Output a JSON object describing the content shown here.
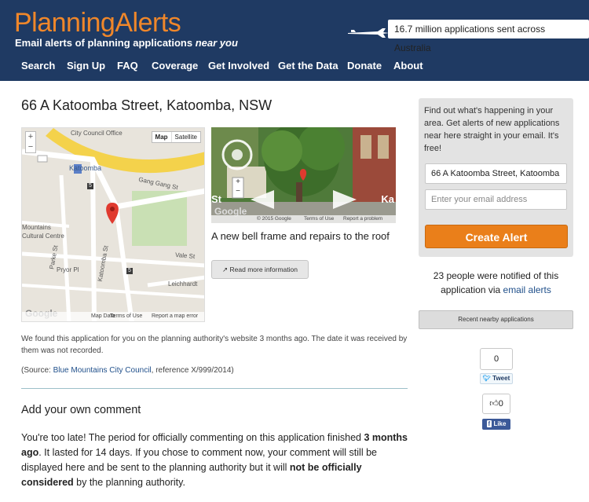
{
  "header": {
    "logo": "PlanningAlerts",
    "tagline_main": "Email alerts of planning applications ",
    "tagline_em": "near you",
    "stat": "16.7 million applications sent across Australia"
  },
  "nav": [
    "Search",
    "Sign Up",
    "FAQ",
    "Coverage",
    "Get Involved",
    "Get the Data",
    "Donate",
    "About"
  ],
  "application": {
    "address": "66 A Katoomba Street, Katoomba, NSW",
    "description": "A new bell frame and repairs to the roof",
    "read_more": "Read more information",
    "found_note": "We found this application for you on the planning authority's website 3 months ago. The date it was received by them was not recorded.",
    "source_prefix": "(Source: ",
    "source_link": "Blue Mountains City Council",
    "source_suffix": ", reference X/999/2014)"
  },
  "map": {
    "mode_map": "Map",
    "mode_satellite": "Satellite",
    "zoom_in": "+",
    "zoom_out": "−",
    "labels": [
      "City Council Office",
      "Katoomba",
      "Gang Gang St",
      "Parke St",
      "Pryor Pl",
      "Vale St",
      "Leichhardt",
      "Katoomba St",
      "Mountains",
      "Cultural Centre"
    ],
    "road_numbers": [
      "5",
      "5"
    ],
    "footer": [
      "Map Data",
      "Terms of Use",
      "Report a map error"
    ],
    "google": "Google"
  },
  "streetview": {
    "left_label": "St",
    "right_label": "Ka",
    "footer": [
      "© 2015 Google",
      "Terms of Use",
      "Report a problem"
    ],
    "google": "Google"
  },
  "comment": {
    "heading": "Add your own comment",
    "p1": "You're too late! The period for officially commenting on this application finished ",
    "p1_bold": "3 months ago",
    "p2": ". It lasted for 14 days. If you chose to comment now, your comment will still be displayed here and be sent to the planning authority but it will ",
    "p2_bold": "not be officially considered",
    "p3": " by the planning authority."
  },
  "sidebar": {
    "signup_text": "Find out what's happening in your area. Get alerts of new applications near here straight in your email. It's free!",
    "address_value": "66 A Katoomba Street, Katoomba",
    "email_placeholder": "Enter your email address",
    "cta": "Create Alert",
    "notified_prefix": "23 people were notified of this application via ",
    "notified_link": "email alerts",
    "nearby": "Recent nearby applications",
    "tweet_count": "0",
    "tweet": "Tweet",
    "like_count": "0",
    "like": "Like"
  },
  "colors": {
    "header_bg": "#1f3a63",
    "logo": "#f0872a",
    "cta": "#ea7f1a",
    "link": "#1f4f8a"
  }
}
